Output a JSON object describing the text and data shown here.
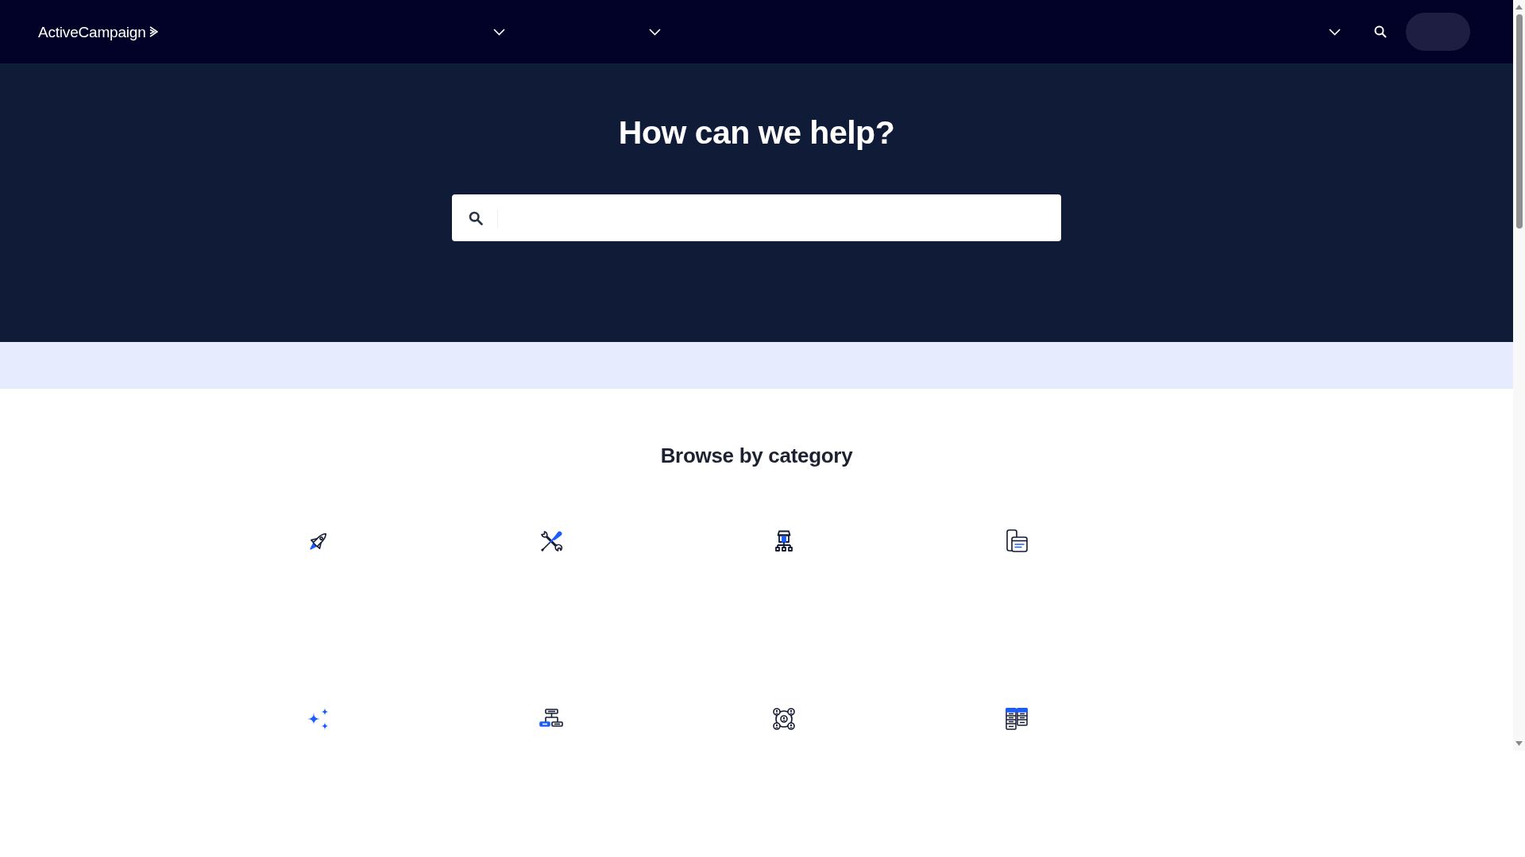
{
  "header": {
    "logo": "ActiveCampaign"
  },
  "hero": {
    "title": "How can we help?"
  },
  "categories": {
    "title": "Browse by category"
  }
}
